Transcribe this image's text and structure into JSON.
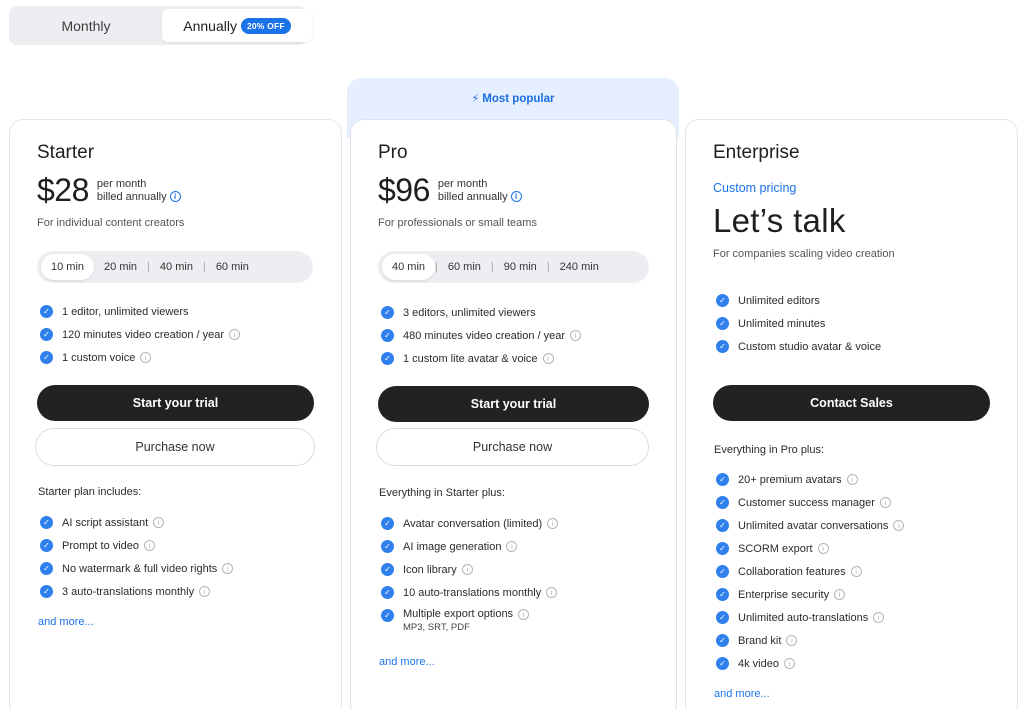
{
  "toggle": {
    "monthly": "Monthly",
    "annually": "Annually",
    "discount_badge": "20% OFF"
  },
  "popular": {
    "label": "Most popular"
  },
  "plans": {
    "starter": {
      "name": "Starter",
      "price": "$28",
      "per": "per month",
      "billed": "billed annually",
      "tagline": "For individual content creators",
      "minutes": [
        "10 min",
        "20 min",
        "40 min",
        "60 min"
      ],
      "selected_minutes": "10 min",
      "features": [
        "1 editor, unlimited viewers",
        "120 minutes video creation / year",
        "1 custom voice"
      ],
      "primary_cta": "Start your trial",
      "secondary_cta": "Purchase now",
      "includes_label": "Starter plan includes:",
      "includes": [
        "AI script assistant",
        "Prompt to video",
        "No watermark & full video rights",
        "3 auto-translations monthly"
      ],
      "more": "and more..."
    },
    "pro": {
      "name": "Pro",
      "price": "$96",
      "per": "per month",
      "billed": "billed annually",
      "tagline": "For professionals or small teams",
      "minutes": [
        "40 min",
        "60 min",
        "90 min",
        "240 min"
      ],
      "selected_minutes": "40 min",
      "features": [
        "3 editors, unlimited viewers",
        "480 minutes video creation / year",
        "1 custom lite avatar & voice"
      ],
      "primary_cta": "Start your trial",
      "secondary_cta": "Purchase now",
      "includes_label": "Everything in Starter plus:",
      "includes": [
        "Avatar conversation (limited)",
        "AI image generation",
        "Icon library",
        "10 auto-translations monthly",
        "Multiple export options"
      ],
      "export_note": "MP3, SRT, PDF",
      "more": "and more..."
    },
    "enterprise": {
      "name": "Enterprise",
      "custom_pricing": "Custom pricing",
      "headline": "Let’s talk",
      "tagline": "For companies scaling video creation",
      "features": [
        "Unlimited editors",
        "Unlimited minutes",
        "Custom studio avatar & voice"
      ],
      "primary_cta": "Contact Sales",
      "includes_label": "Everything in Pro plus:",
      "includes": [
        "20+ premium avatars",
        "Customer success manager",
        "Unlimited avatar conversations",
        "SCORM export",
        "Collaboration features",
        "Enterprise security",
        "Unlimited auto-translations",
        "Brand kit",
        "4k video"
      ],
      "more": "and more..."
    }
  },
  "colors": {
    "accent": "#1a73e8",
    "check": "#2f80ed",
    "dark_button": "#222222",
    "popular_band": "#e6efff"
  }
}
